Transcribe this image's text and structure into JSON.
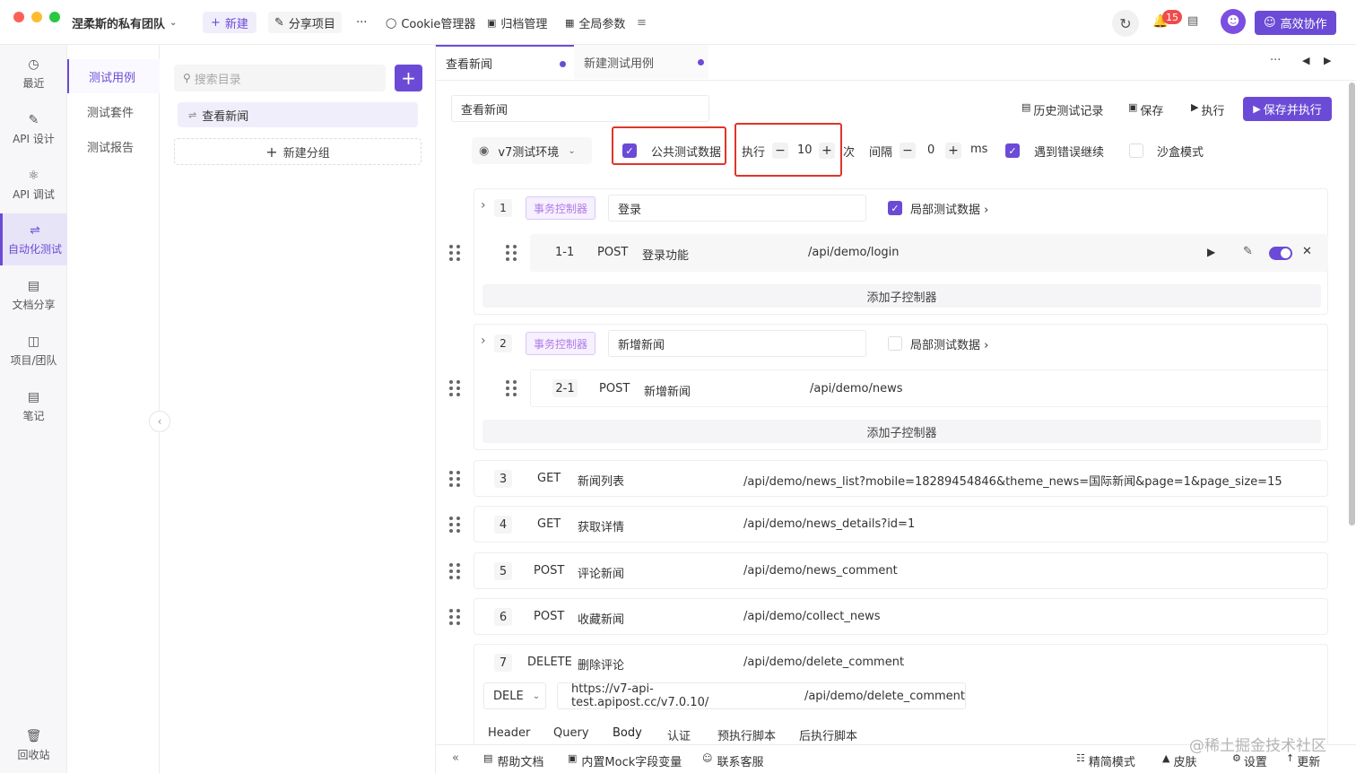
{
  "topbar": {
    "team_name": "涅柔斯的私有团队",
    "new_label": "新建",
    "share_label": "分享项目",
    "more_label": "···",
    "cookie_label": "Cookie管理器",
    "archive_label": "归档管理",
    "global_params_label": "全局参数",
    "notification_count": "15",
    "collab_label": "高效协作"
  },
  "leftnav": {
    "items": [
      {
        "label": "最近",
        "icon": "clock-icon"
      },
      {
        "label": "API 设计",
        "icon": "edit-icon"
      },
      {
        "label": "API 调试",
        "icon": "debug-icon"
      },
      {
        "label": "自动化测试",
        "icon": "flow-icon"
      },
      {
        "label": "文档分享",
        "icon": "doc-icon"
      },
      {
        "label": "项目/团队",
        "icon": "project-icon"
      },
      {
        "label": "笔记",
        "icon": "note-icon"
      }
    ],
    "recycle_label": "回收站"
  },
  "subnav": {
    "items": [
      "测试用例",
      "测试套件",
      "测试报告"
    ]
  },
  "tree": {
    "search_placeholder": "搜索目录",
    "item": "查看新闻",
    "new_group": "新建分组"
  },
  "tabs": [
    {
      "label": "查看新闻"
    },
    {
      "label": "新建测试用例"
    }
  ],
  "header": {
    "case_name": "查看新闻",
    "history": "历史测试记录",
    "save": "保存",
    "run": "执行",
    "save_run": "保存并执行"
  },
  "config": {
    "env": "v7测试环境",
    "public_data": "公共测试数据",
    "exec_label": "执行",
    "exec_count": "10",
    "times_label": "次",
    "interval_label": "间隔",
    "interval_value": "0",
    "ms_label": "ms",
    "continue_on_error": "遇到错误继续",
    "sandbox": "沙盒模式"
  },
  "controllers": [
    {
      "index": "1",
      "type": "事务控制器",
      "name": "登录",
      "local_data": "局部测试数据",
      "step": {
        "index": "1-1",
        "method": "POST",
        "name": "登录功能",
        "path": "/api/demo/login"
      },
      "add_sub": "添加子控制器"
    },
    {
      "index": "2",
      "type": "事务控制器",
      "name": "新增新闻",
      "local_data": "局部测试数据",
      "step": {
        "index": "2-1",
        "method": "POST",
        "name": "新增新闻",
        "path": "/api/demo/news"
      },
      "add_sub": "添加子控制器"
    }
  ],
  "steps": [
    {
      "index": "3",
      "method": "GET",
      "name": "新闻列表",
      "path": "/api/demo/news_list?mobile=18289454846&theme_news=国际新闻&page=1&page_size=15"
    },
    {
      "index": "4",
      "method": "GET",
      "name": "获取详情",
      "path": "/api/demo/news_details?id=1"
    },
    {
      "index": "5",
      "method": "POST",
      "name": "评论新闻",
      "path": "/api/demo/news_comment"
    },
    {
      "index": "6",
      "method": "POST",
      "name": "收藏新闻",
      "path": "/api/demo/collect_news"
    },
    {
      "index": "7",
      "method": "DELETE",
      "name": "删除评论",
      "path": "/api/demo/delete_comment"
    }
  ],
  "expanded": {
    "method": "DELE",
    "base_url": "https://v7-api-test.apipost.cc/v7.0.10/",
    "path": "/api/demo/delete_comment",
    "subtabs": [
      "Header",
      "Query",
      "Body",
      "认证",
      "预执行脚本",
      "后执行脚本"
    ]
  },
  "bottombar": {
    "help": "帮助文档",
    "mock": "内置Mock字段变量",
    "support": "联系客服",
    "simple_mode": "精简模式",
    "skin": "皮肤",
    "settings": "设置",
    "update": "更新",
    "watermark": "@稀土掘金技术社区"
  }
}
